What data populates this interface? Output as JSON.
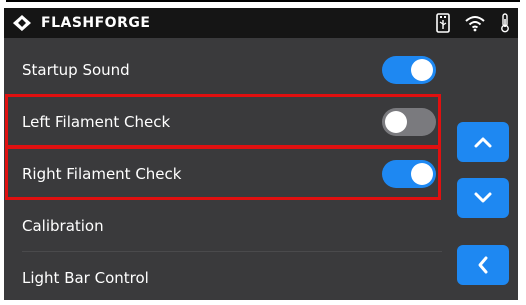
{
  "brand": {
    "name": "FLASHFORGE"
  },
  "status_icons": [
    "usb-icon",
    "wifi-icon",
    "thermometer-icon"
  ],
  "colors": {
    "accent": "#1e88f2",
    "highlight": "#e01010",
    "panel": "#3a3a3c",
    "statusbar": "#151515"
  },
  "settings": {
    "items": [
      {
        "label": "Startup Sound",
        "toggle": "on"
      },
      {
        "label": "Left Filament Check",
        "toggle": "off"
      },
      {
        "label": "Right Filament Check",
        "toggle": "on"
      },
      {
        "label": "Calibration"
      },
      {
        "label": "Light Bar Control"
      }
    ]
  },
  "nav": {
    "buttons": [
      "chevron-up-icon",
      "chevron-down-icon",
      "back-icon"
    ]
  }
}
